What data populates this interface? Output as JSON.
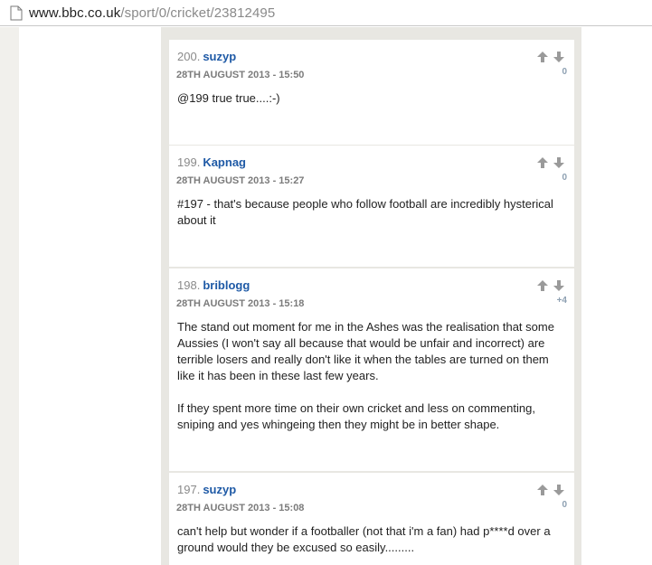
{
  "browser": {
    "url_host": "www.bbc.co.uk",
    "url_path": "/sport/0/cricket/23812495"
  },
  "comments": [
    {
      "number": "200.",
      "user": "suzyp",
      "date": "28TH AUGUST 2013 - 15:50",
      "score": "0",
      "paragraphs": [
        "@199 true true....:-)"
      ]
    },
    {
      "number": "199.",
      "user": "Kapnag",
      "date": "28TH AUGUST 2013 - 15:27",
      "score": "0",
      "paragraphs": [
        "#197 - that's because people who follow football are incredibly hysterical about it"
      ]
    },
    {
      "number": "198.",
      "user": "briblogg",
      "date": "28TH AUGUST 2013 - 15:18",
      "score": "+4",
      "paragraphs": [
        "The stand out moment for me in the Ashes was the realisation that some Aussies (I won't say all because that would be unfair and incorrect) are terrible losers and really don't like it when the tables are turned on them like it has been in these last few years.",
        "If they spent more time on their own cricket and less on commenting, sniping and yes whingeing then they might be in better shape."
      ]
    },
    {
      "number": "197.",
      "user": "suzyp",
      "date": "28TH AUGUST 2013 - 15:08",
      "score": "0",
      "paragraphs": [
        "can't help but wonder if a footballer (not that i'm a fan) had p****d over a ground would they be excused so easily........."
      ]
    }
  ],
  "icons": {
    "page": "page-icon",
    "vote_up": "arrow-up-icon",
    "vote_down": "arrow-down-icon"
  }
}
